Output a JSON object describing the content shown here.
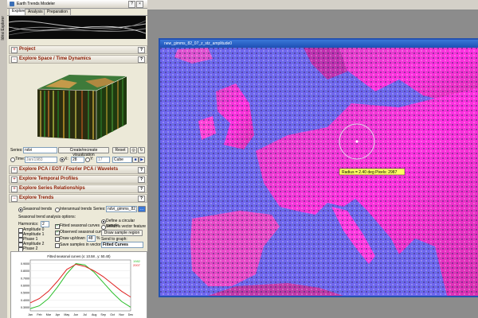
{
  "side_tab": "Idrisi Explorer",
  "app": {
    "title": "Earth Trends Modeler"
  },
  "tabs": [
    "Explore",
    "Analysis",
    "Preparation"
  ],
  "sections": {
    "project": "Project",
    "space_time": "Explore Space / Time Dynamics",
    "pca": "Explore PCA / EOT / Fourier PCA / Wavelets",
    "profiles": "Explore Temporal Profiles",
    "series": "Explore Series Relationships",
    "trends": "Explore Trends",
    "help": "?"
  },
  "space_time_controls": {
    "series_label": "Series:",
    "series_value": "ndvi",
    "create_btn": "Create/recreate visualization",
    "reset_btn": "Reset",
    "time_label": "Time:",
    "time_value": "Jan/1983",
    "x_label": "X:",
    "x_value": "28",
    "y_label": "Y:",
    "y_value": "17",
    "cube_value": "Cube"
  },
  "trends": {
    "seasonal_label": "Seasonal trends",
    "interannual_label": "Interannual trends",
    "series_label": "Series:",
    "series_value": "ndvi_gimms_82_07_s...",
    "analysis_options": "Seasonal trend analysis options:",
    "harmonics_label": "Harmonics:",
    "harmonics_value": "2",
    "params": [
      "Amplitude 0",
      "Amplitude 1",
      "Phase 1",
      "Amplitude 2",
      "Phase 2"
    ],
    "fitted_curves": "Fitted seasonal curves",
    "observed_curves": "Observed seasonal curves",
    "draw_label": "Draw up/down",
    "draw_value": "48",
    "draw_unit": "%",
    "save_samples": "Save samples in vector layer",
    "define_circular": "Define a circular sample",
    "select_vector": "Select a vector feature",
    "draw_sample_btn": "Draw sample region",
    "send_graph": "Send to graph:",
    "send_value": "Fitted Curves"
  },
  "colors": {
    "series_1982": "#2bbf2b",
    "series_2007": "#e02020",
    "header_text": "#8b1a00"
  },
  "chart_data": {
    "type": "line",
    "title": "Fitted seasonal curves (x: 10.58 , y: 50.40)",
    "categories": [
      "Jan",
      "Feb",
      "Mar",
      "Apr",
      "May",
      "Jun",
      "Jul",
      "Aug",
      "Sep",
      "Oct",
      "Nov",
      "Dec"
    ],
    "y_ticks": [
      "0.9000",
      "0.8000",
      "0.7000",
      "0.6000",
      "0.5000",
      "0.4000",
      "0.3000"
    ],
    "ylim": [
      0.25,
      0.95
    ],
    "series": [
      {
        "name": "1982",
        "color": "#2bbf2b",
        "values": [
          0.28,
          0.32,
          0.42,
          0.58,
          0.76,
          0.9,
          0.88,
          0.78,
          0.64,
          0.5,
          0.38,
          0.3
        ]
      },
      {
        "name": "2007",
        "color": "#e02020",
        "values": [
          0.36,
          0.42,
          0.52,
          0.66,
          0.82,
          0.89,
          0.86,
          0.8,
          0.72,
          0.62,
          0.52,
          0.44
        ]
      }
    ]
  },
  "map": {
    "window_title": "new_gimms_82_07_z_stz_amplitude0",
    "tooltip": "Radius = 2.40 deg Pixels: 2987"
  }
}
